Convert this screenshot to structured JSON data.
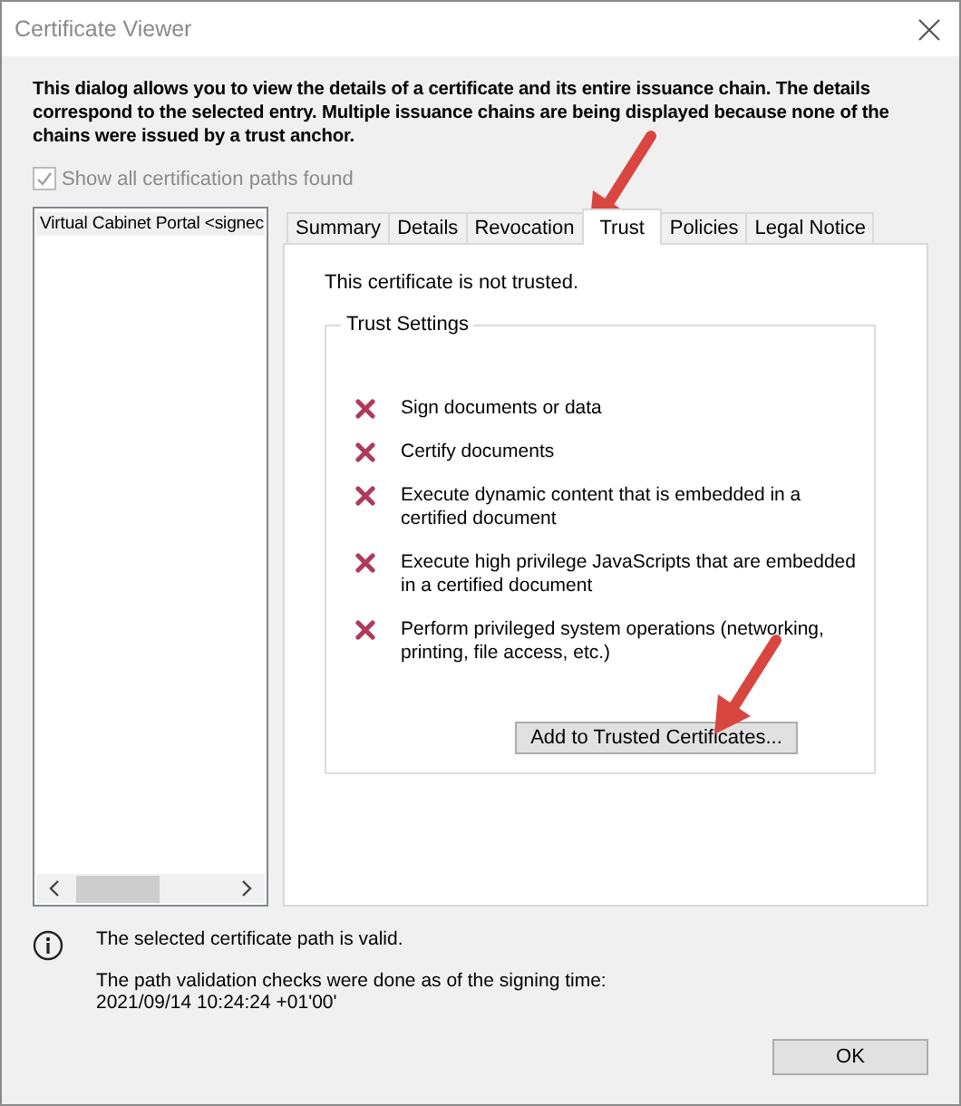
{
  "window": {
    "title": "Certificate Viewer"
  },
  "description": "This dialog allows you to view the details of a certificate and its entire issuance chain. The details correspond to the selected entry. Multiple issuance chains are being displayed because none of the chains were issued by a trust anchor.",
  "show_all_paths": {
    "label": "Show all certification paths found",
    "checked": true,
    "disabled": true
  },
  "certificate_list": [
    {
      "label": "Virtual Cabinet Portal <signec",
      "selected": true
    }
  ],
  "tabs": [
    {
      "label": "Summary",
      "selected": false
    },
    {
      "label": "Details",
      "selected": false
    },
    {
      "label": "Revocation",
      "selected": false
    },
    {
      "label": "Trust",
      "selected": true
    },
    {
      "label": "Policies",
      "selected": false
    },
    {
      "label": "Legal Notice",
      "selected": false
    }
  ],
  "trust": {
    "status": "This certificate is not trusted.",
    "group_title": "Trust Settings",
    "settings": [
      {
        "label": "Sign documents or data",
        "allowed": false
      },
      {
        "label": "Certify documents",
        "allowed": false
      },
      {
        "label": "Execute dynamic content that is embedded in a certified document",
        "allowed": false
      },
      {
        "label": "Execute high privilege JavaScripts that are embedded in a certified document",
        "allowed": false
      },
      {
        "label": "Perform privileged system operations (networking, printing, file access, etc.)",
        "allowed": false
      }
    ],
    "button": "Add to Trusted Certificates..."
  },
  "validity": {
    "message": "The selected certificate path is valid.",
    "checks_note": "The path validation checks were done as of the signing time:",
    "time": "2021/09/14 10:24:24 +01'00'"
  },
  "buttons": [
    "OK"
  ]
}
